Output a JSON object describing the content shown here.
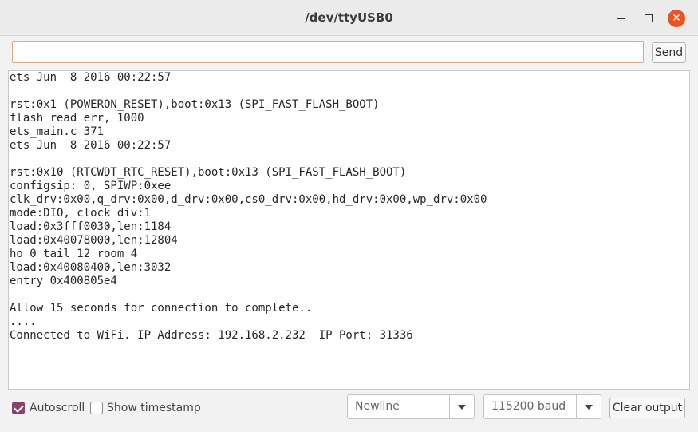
{
  "window": {
    "title": "/dev/ttyUSB0",
    "close_glyph": "✕"
  },
  "send": {
    "input_value": "",
    "button_label": "Send"
  },
  "output": {
    "text": "ets Jun  8 2016 00:22:57\n\nrst:0x1 (POWERON_RESET),boot:0x13 (SPI_FAST_FLASH_BOOT)\nflash read err, 1000\nets_main.c 371\nets Jun  8 2016 00:22:57\n\nrst:0x10 (RTCWDT_RTC_RESET),boot:0x13 (SPI_FAST_FLASH_BOOT)\nconfigsip: 0, SPIWP:0xee\nclk_drv:0x00,q_drv:0x00,d_drv:0x00,cs0_drv:0x00,hd_drv:0x00,wp_drv:0x00\nmode:DIO, clock div:1\nload:0x3fff0030,len:1184\nload:0x40078000,len:12804\nho 0 tail 12 room 4\nload:0x40080400,len:3032\nentry 0x400805e4\n\nAllow 15 seconds for connection to complete..\n....\nConnected to WiFi. IP Address: 192.168.2.232  IP Port: 31336"
  },
  "footer": {
    "autoscroll_label": "Autoscroll",
    "autoscroll_checked": true,
    "timestamp_label": "Show timestamp",
    "timestamp_checked": false,
    "line_ending_selected": "Newline",
    "baud_selected": "115200 baud",
    "clear_label": "Clear output"
  },
  "colors": {
    "accent": "#87436b",
    "close_button": "#e9541f",
    "input_border": "#e2a58a"
  }
}
